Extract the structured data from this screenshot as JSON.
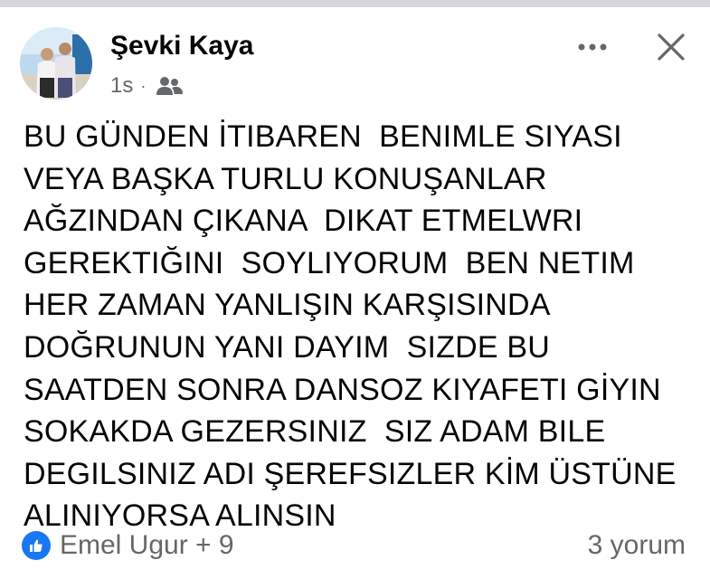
{
  "post": {
    "author_name": "Şevki Kaya",
    "timestamp": "1s",
    "separator": "·",
    "audience_icon": "friends-icon",
    "body_lines": [
      "BU GÜNDEN İTIBAREN  BENIMLE SIYASI",
      "VEYA BAŞKA TURLU KONUŞANLAR",
      "AĞZINDAN ÇIKANA  DIKAT ETMELWRI",
      "GEREKTIĞINI  SOYLIYORUM  BEN NETIM",
      "HER ZAMAN YANLIŞIN KARŞISINDA",
      "DOĞRUNUN YANI DAYIM  SIZDE BU",
      "SAATDEN SONRA DANSOZ KIYAFETI GİYIN",
      "SOKAKDA GEZERSINIZ  SIZ ADAM BILE",
      "DEGILSINIZ ADI ŞEREFSIZLER KİM ÜSTÜNE",
      "ALINIYORSA ALINSIN"
    ]
  },
  "footer": {
    "reactions_text": "Emel Ugur + 9",
    "reaction_icon": "like-icon",
    "comments_text": "3 yorum"
  },
  "icons": {
    "more": "more-options-icon",
    "close": "close-icon"
  },
  "colors": {
    "text_primary": "#050505",
    "text_secondary": "#65676b",
    "like_blue": "#1877f2",
    "top_rule": "#d7d8dc"
  }
}
